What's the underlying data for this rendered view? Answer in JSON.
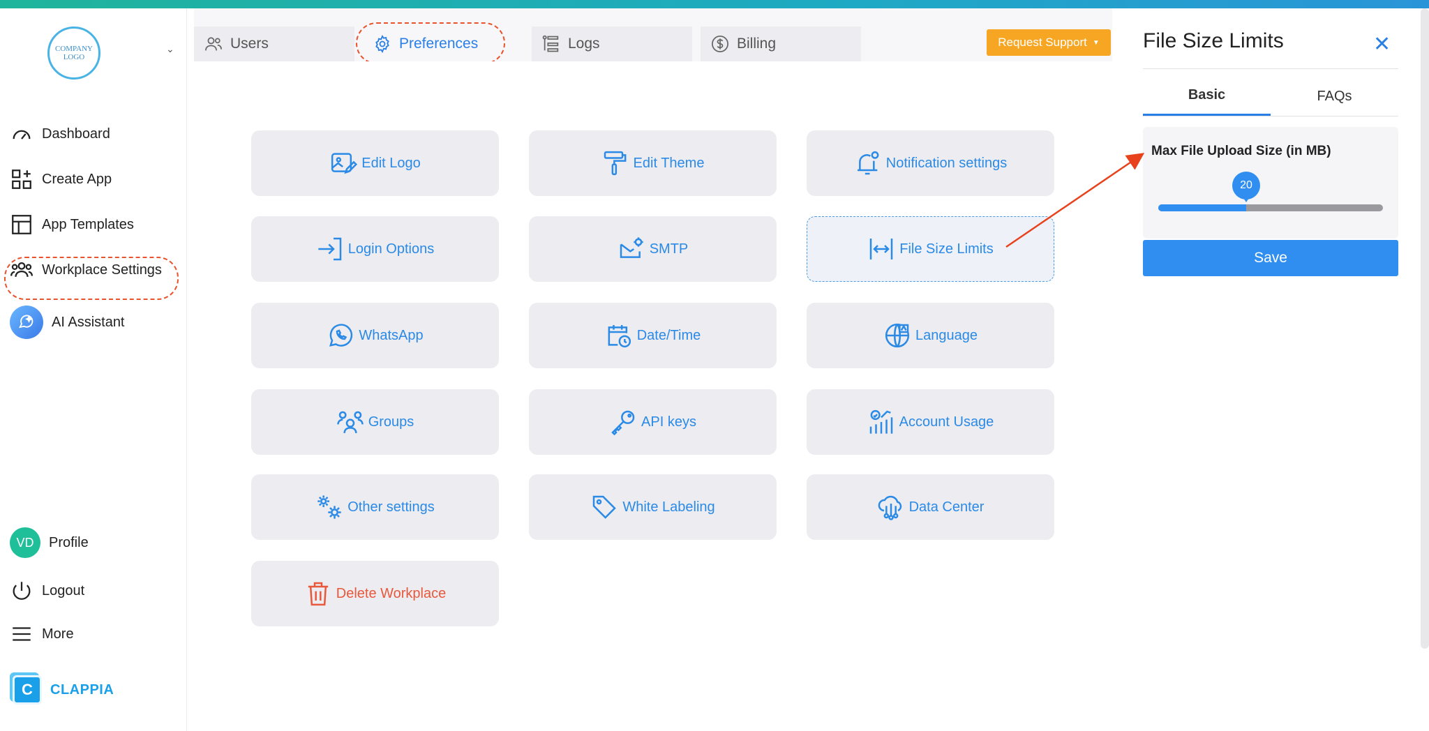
{
  "sidebar": {
    "logo_text_line1": "COMPANY",
    "logo_text_line2": "LOGO",
    "items": [
      {
        "label": "Dashboard"
      },
      {
        "label": "Create App"
      },
      {
        "label": "App Templates"
      },
      {
        "label": "Workplace Settings"
      },
      {
        "label": "AI Assistant"
      }
    ],
    "profile": {
      "initials": "VD",
      "label": "Profile"
    },
    "logout_label": "Logout",
    "more_label": "More",
    "brand": {
      "mark": "C",
      "name": "CLAPPIA"
    }
  },
  "tabs": [
    {
      "label": "Users"
    },
    {
      "label": "Preferences"
    },
    {
      "label": "Logs"
    },
    {
      "label": "Billing"
    }
  ],
  "request_support": {
    "label": "Request Support"
  },
  "settings_grid": [
    {
      "label": "Edit Logo"
    },
    {
      "label": "Edit Theme"
    },
    {
      "label": "Notification settings"
    },
    {
      "label": "Login Options"
    },
    {
      "label": "SMTP"
    },
    {
      "label": "File Size Limits"
    },
    {
      "label": "WhatsApp"
    },
    {
      "label": "Date/Time"
    },
    {
      "label": "Language"
    },
    {
      "label": "Groups"
    },
    {
      "label": "API keys"
    },
    {
      "label": "Account Usage"
    },
    {
      "label": "Other settings"
    },
    {
      "label": "White Labeling"
    },
    {
      "label": "Data Center"
    },
    {
      "label": "Delete Workplace"
    }
  ],
  "panel": {
    "title": "File Size Limits",
    "tabs": [
      {
        "label": "Basic"
      },
      {
        "label": "FAQs"
      }
    ],
    "field_label": "Max File Upload Size (in MB)",
    "slider_value": "20",
    "slider_fill_fraction": 0.39,
    "save_label": "Save"
  },
  "colors": {
    "accent": "#2a8ae6",
    "highlight": "#e8522c",
    "warning": "#f6a623",
    "danger": "#e8583a"
  }
}
